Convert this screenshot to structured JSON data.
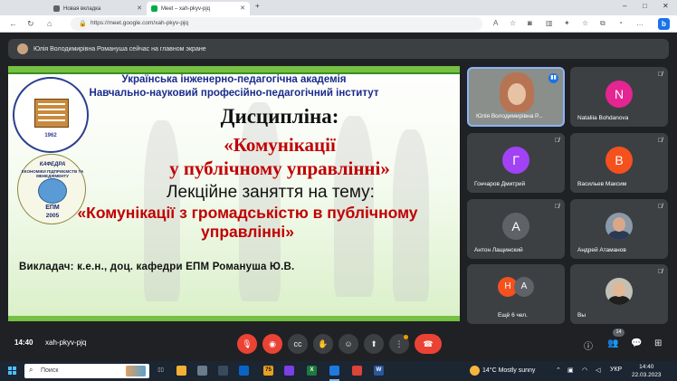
{
  "browser": {
    "tabs": [
      {
        "label": "Новая вкладка"
      },
      {
        "label": "Meet – xah-pkyv-pjq"
      }
    ],
    "url": "https://meet.google.com/xah-pkyv-pjq",
    "edge_badge": "b"
  },
  "meet": {
    "presenter_notice": "Юлія Володимирівна Романуша сейчас на главном экране",
    "clock": "14:40",
    "meeting_code": "xah-pkyv-pjq",
    "participant_count": "14"
  },
  "slide": {
    "academy": "Українська інженерно-педагогічна академія",
    "institute": "Навчально-науковий професійно-педагогічний інститут",
    "discipline": "Дисципліна:",
    "course_line1": "«Комунікації",
    "course_line2": "у публічному управлінні»",
    "lecture": "Лекційне заняття на тему:",
    "topic_line1": "«Комунікації з громадськістю в публічному",
    "topic_line2": "управлінні»",
    "lecturer": "Викладач: к.е.н., доц. кафедри ЕПМ Романуша Ю.В.",
    "logo1_year": "1962",
    "logo2_kafedra": "КАФЕДРА",
    "logo2_name": "ЕКОНОМІКИ ПІДПРИЄМСТВ ТА МЕНЕДЖМЕНТУ",
    "logo2_abbr": "ЕПМ",
    "logo2_year": "2005"
  },
  "participants": [
    {
      "name": "Юлія Володимирівна Р...",
      "type": "video"
    },
    {
      "name": "Nataliia Bohdanova",
      "initial": "N",
      "color": "#e52592"
    },
    {
      "name": "Гончаров Дмитрий",
      "initial": "Г",
      "color": "#a142f4"
    },
    {
      "name": "Васильев Максим",
      "initial": "В",
      "color": "#f4511e"
    },
    {
      "name": "Антон Лащинский",
      "initial": "А",
      "color": "#5f6368"
    },
    {
      "name": "Андрей Атаманов",
      "type": "photo"
    },
    {
      "name": "Ещё 6 чел.",
      "initials": [
        "Н",
        "А"
      ],
      "colors": [
        "#f4511e",
        "#5f6368"
      ]
    },
    {
      "name": "Вы",
      "type": "photo"
    }
  ],
  "taskbar": {
    "search_placeholder": "Поиск",
    "weather": "14°C  Mostly sunny",
    "lang": "УКР",
    "time": "14:40",
    "date": "22.03.2023",
    "badge": "75"
  }
}
